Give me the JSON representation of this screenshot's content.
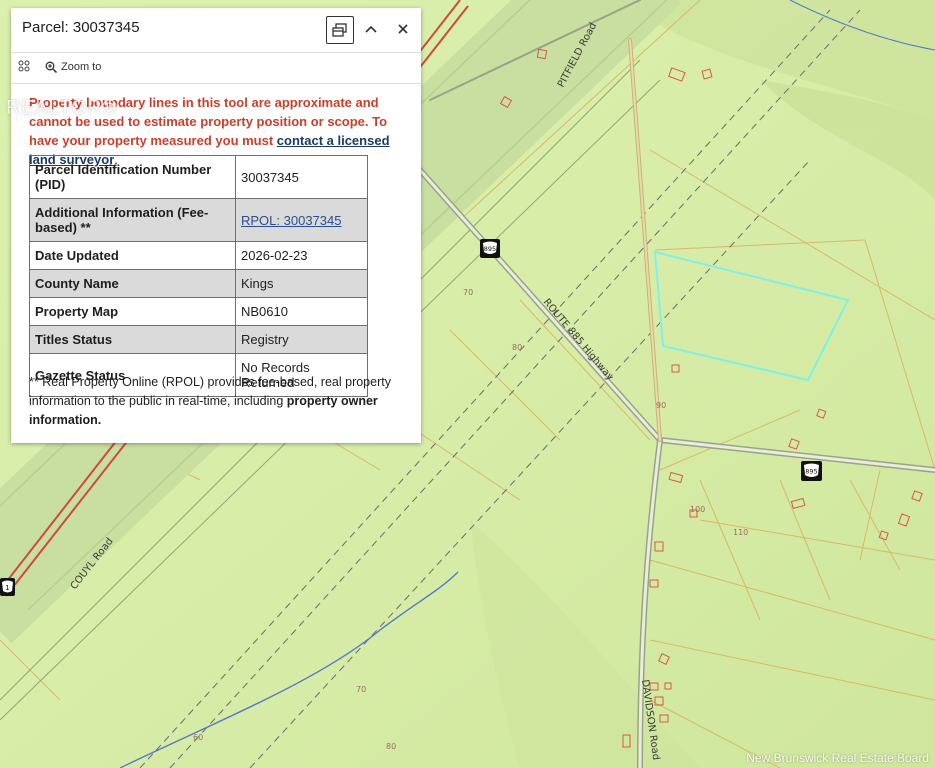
{
  "popup": {
    "title": "Parcel: 30037345",
    "zoom_label": "Zoom to",
    "watermark": "REALTOR®",
    "warning": {
      "text": "Property boundary lines in this tool are approximate and cannot be used to estimate property position or scope. To have your property measured you must ",
      "link": "contact a licensed land surveyor",
      "end": "."
    },
    "table": [
      {
        "key": "Parcel Identification Number (PID)",
        "value": "30037345"
      },
      {
        "key": "Additional Information (Fee-based) **",
        "value": "RPOL: 30037345"
      },
      {
        "key": "Date Updated",
        "value": "2026-02-23"
      },
      {
        "key": "County Name",
        "value": "Kings"
      },
      {
        "key": "Property Map",
        "value": "NB0610"
      },
      {
        "key": "Titles Status",
        "value": "Registry"
      },
      {
        "key": "Gazette Status",
        "value": "No Records Returned"
      }
    ],
    "footnote": {
      "text": "** Real Property Online (RPOL) provides fee-based, real property information to the public in real-time, including ",
      "bold": "property owner information."
    }
  },
  "map": {
    "roads": {
      "pitfield": "PITFIELD Road",
      "route885": "ROUTE 885 Highway",
      "couyl": "COUYL Road",
      "davidson": "DAVIDSON Road"
    },
    "shields": {
      "shield_a": "895",
      "shield_b": "895",
      "shield_c": "1"
    },
    "contours": [
      "70",
      "80",
      "90",
      "100",
      "110",
      "70",
      "80",
      "60"
    ],
    "colors": {
      "land": "#d9efac",
      "parcel_highlight": "#7ff0e6",
      "parcel_lines": "#d9b86a",
      "building": "#d9584a",
      "stream": "#4f78c8"
    }
  },
  "credit": "New Brunswick Real Estate Board"
}
